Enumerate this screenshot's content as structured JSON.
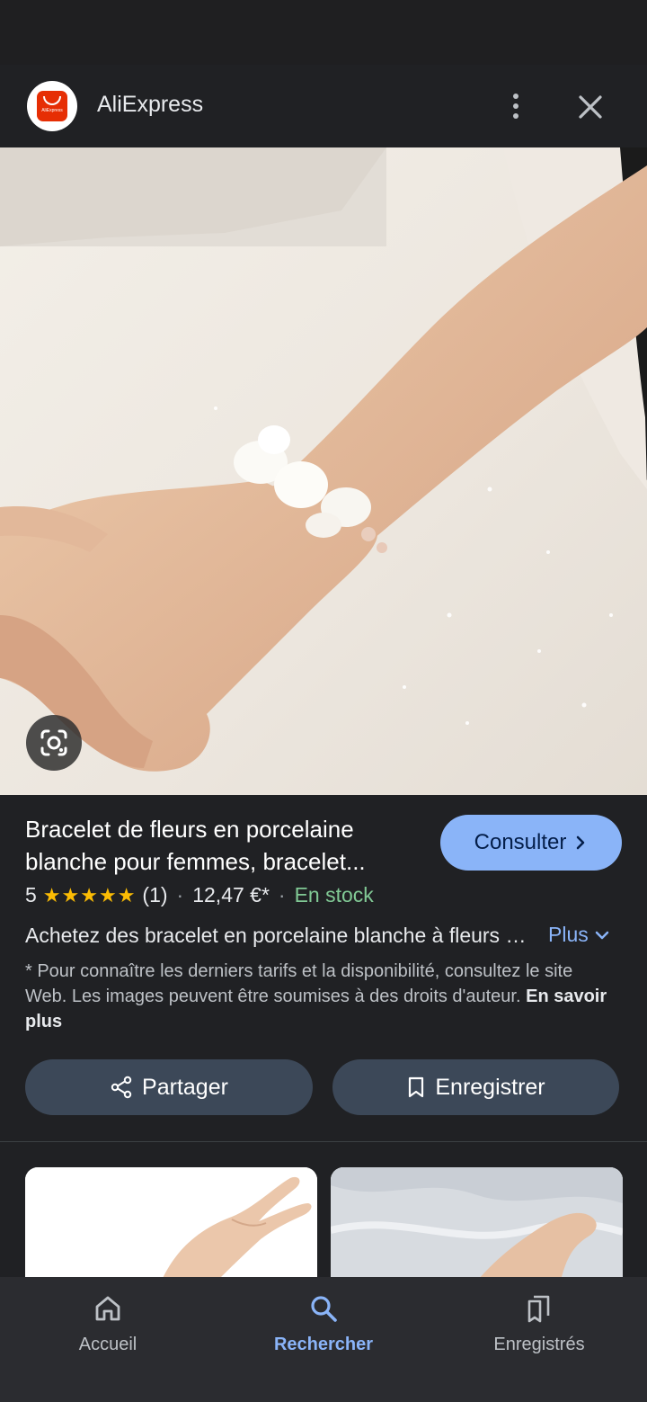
{
  "source": {
    "name": "AliExpress",
    "logo_text": "AliExpress"
  },
  "product": {
    "title": "Bracelet de fleurs en porcelaine blanche pour femmes, bracelet...",
    "consult_label": "Consulter",
    "rating_value": "5",
    "stars": "★★★★★",
    "review_count": "(1)",
    "price": "12,47 €*",
    "availability": "En stock",
    "description": "Achetez des bracelet en porcelaine blanche à fleurs pour femmes",
    "more_label": "Plus",
    "disclaimer": "* Pour connaître les derniers tarifs et la disponibilité, consultez le site Web. Les images peuvent être soumises à des droits d'auteur.",
    "learn_more": "En savoir plus"
  },
  "actions": {
    "share_label": "Partager",
    "save_label": "Enregistrer"
  },
  "bottom_nav": {
    "items": [
      {
        "label": "Accueil",
        "icon": "home-icon",
        "active": false
      },
      {
        "label": "Rechercher",
        "icon": "search-icon",
        "active": true
      },
      {
        "label": "Enregistrés",
        "icon": "saved-collections-icon",
        "active": false
      }
    ]
  },
  "colors": {
    "background": "#202124",
    "accent": "#8ab4f8",
    "stars": "#fbbc04",
    "in_stock": "#81c995",
    "aliexpress_red": "#e62e04"
  }
}
